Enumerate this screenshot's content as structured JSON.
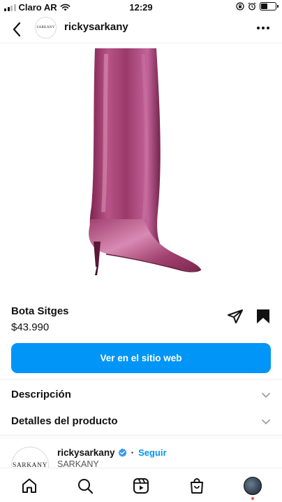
{
  "status_bar": {
    "carrier": "Claro AR",
    "time": "12:29"
  },
  "header": {
    "avatar_text": "SARKANY",
    "username": "rickysarkany"
  },
  "product": {
    "name": "Bota Sitges",
    "price": "$43.990",
    "cta_label": "Ver en el sitio web",
    "image_icon": "pink-metallic-boot-image"
  },
  "sections": {
    "description_label": "Descripción",
    "details_label": "Detalles del producto"
  },
  "seller": {
    "avatar_text": "SARKANY",
    "username": "rickysarkany",
    "separator": "·",
    "follow_label": "Seguir",
    "display_name": "SARKANY"
  },
  "colors": {
    "accent": "#0095f6",
    "notification_dot": "#ed4956"
  }
}
